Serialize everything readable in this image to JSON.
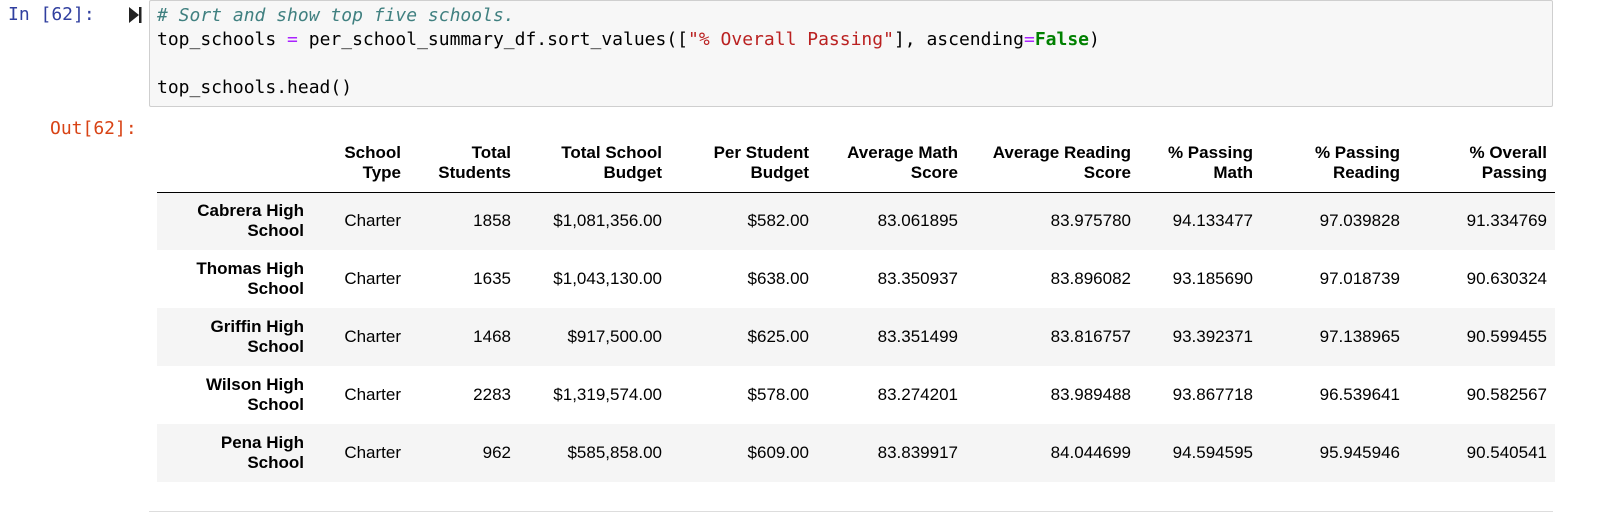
{
  "input_prompt": "In [62]:",
  "output_prompt": "Out[62]:",
  "code": {
    "comment": "# Sort and show top five schools.",
    "line2_var": "top_schools ",
    "line2_eq": "=",
    "line2_mid": " per_school_summary_df.sort_values([",
    "line2_str": "\"% Overall Passing\"",
    "line2_after": "], ascending",
    "line2_eq2": "=",
    "line2_kw": "False",
    "line2_end": ")",
    "line4": "top_schools.head()"
  },
  "table": {
    "columns": [
      {
        "line1": "School",
        "line2": "Type"
      },
      {
        "line1": "Total",
        "line2": "Students"
      },
      {
        "line1": "Total School",
        "line2": "Budget"
      },
      {
        "line1": "Per Student",
        "line2": "Budget"
      },
      {
        "line1": "Average Math",
        "line2": "Score"
      },
      {
        "line1": "Average Reading",
        "line2": "Score"
      },
      {
        "line1": "% Passing",
        "line2": "Math"
      },
      {
        "line1": "% Passing",
        "line2": "Reading"
      },
      {
        "line1": "% Overall",
        "line2": "Passing"
      }
    ],
    "rows": [
      {
        "name1": "Cabrera High",
        "name2": "School",
        "cells": [
          "Charter",
          "1858",
          "$1,081,356.00",
          "$582.00",
          "83.061895",
          "83.975780",
          "94.133477",
          "97.039828",
          "91.334769"
        ]
      },
      {
        "name1": "Thomas High",
        "name2": "School",
        "cells": [
          "Charter",
          "1635",
          "$1,043,130.00",
          "$638.00",
          "83.350937",
          "83.896082",
          "93.185690",
          "97.018739",
          "90.630324"
        ]
      },
      {
        "name1": "Griffin High",
        "name2": "School",
        "cells": [
          "Charter",
          "1468",
          "$917,500.00",
          "$625.00",
          "83.351499",
          "83.816757",
          "93.392371",
          "97.138965",
          "90.599455"
        ]
      },
      {
        "name1": "Wilson High",
        "name2": "School",
        "cells": [
          "Charter",
          "2283",
          "$1,319,574.00",
          "$578.00",
          "83.274201",
          "83.989488",
          "93.867718",
          "96.539641",
          "90.582567"
        ]
      },
      {
        "name1": "Pena High",
        "name2": "School",
        "cells": [
          "Charter",
          "962",
          "$585,858.00",
          "$609.00",
          "83.839917",
          "84.044699",
          "94.594595",
          "95.945946",
          "90.540541"
        ]
      }
    ]
  },
  "icons": {
    "run": "run-cell-icon"
  },
  "colors": {
    "input_prompt": "#303f9f",
    "output_prompt": "#d84315",
    "comment": "#408080",
    "operator": "#aa22ff",
    "string": "#ba2121",
    "keyword": "#008000"
  }
}
